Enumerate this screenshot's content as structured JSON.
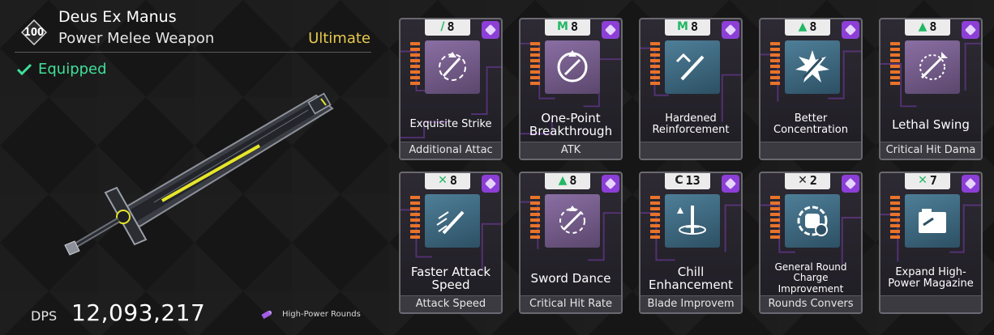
{
  "weapon": {
    "level": "100",
    "name": "Deus Ex Manus",
    "type": "Power Melee Weapon",
    "rarity": "Ultimate",
    "status": "Equipped",
    "dps_label": "DPS",
    "dps_value": "12,093,217",
    "ammo_type": "High-Power Rounds"
  },
  "colors": {
    "accent_green": "#3fe09a",
    "rarity_gold": "#e9c94e",
    "slot_purple": "#8c3fd6",
    "capacity_orange": "#e8732a"
  },
  "mods": [
    {
      "name": "Exquisite Strike",
      "effect": "Additional Attac",
      "cost": "8",
      "socket_icon": "socket-slash-icon",
      "icon": "exquisite-strike-icon",
      "tile": "purple"
    },
    {
      "name": "One-Point Breakthrough",
      "effect": "ATK",
      "cost": "8",
      "socket_icon": "socket-m-icon",
      "icon": "breakthrough-icon",
      "tile": "purple"
    },
    {
      "name": "Hardened Reinforcement",
      "effect": "",
      "cost": "8",
      "socket_icon": "socket-m-icon",
      "icon": "sword-chevron-icon",
      "tile": "blue"
    },
    {
      "name": "Better Concentration",
      "effect": "",
      "cost": "8",
      "socket_icon": "socket-triangle-icon",
      "icon": "concentration-icon",
      "tile": "blue"
    },
    {
      "name": "Lethal Swing",
      "effect": "Critical Hit Dama",
      "cost": "8",
      "socket_icon": "socket-triangle-icon",
      "icon": "lethal-swing-icon",
      "tile": "purple"
    },
    {
      "name": "Faster Attack Speed",
      "effect": "Attack Speed",
      "cost": "8",
      "socket_icon": "socket-x-icon",
      "icon": "attack-speed-icon",
      "tile": "blue"
    },
    {
      "name": "Sword Dance",
      "effect": "Critical Hit Rate",
      "cost": "8",
      "socket_icon": "socket-triangle-icon",
      "icon": "sword-dance-icon",
      "tile": "purple"
    },
    {
      "name": "Chill Enhancement",
      "effect": "Blade Improvem",
      "cost": "13",
      "socket_icon": "socket-c-icon",
      "icon": "chill-sword-icon",
      "tile": "blue"
    },
    {
      "name": "General Round Charge Improvement",
      "effect": "Rounds Convers",
      "cost": "2",
      "socket_icon": "socket-x-icon",
      "icon": "round-charge-icon",
      "tile": "blue"
    },
    {
      "name": "Expand High-Power Magazine",
      "effect": "",
      "cost": "7",
      "socket_icon": "socket-x-icon",
      "icon": "magazine-icon",
      "tile": "blue"
    }
  ]
}
